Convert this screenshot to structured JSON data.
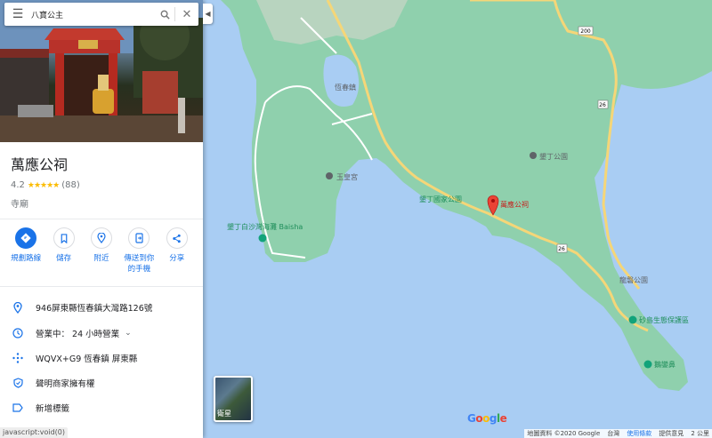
{
  "search": {
    "value": "八寶公主"
  },
  "place": {
    "name": "萬應公祠",
    "rating": "4.2",
    "review_count": "(88)",
    "star_display": "★★★★★",
    "category": "寺廟"
  },
  "actions": [
    {
      "label": "規劃路線"
    },
    {
      "label": "儲存"
    },
    {
      "label": "附近"
    },
    {
      "label": "傳送到你的手機"
    },
    {
      "label": "分享"
    }
  ],
  "info": {
    "address": "946屏東縣恆春鎮大灣路126號",
    "hours": "營業中： 24 小時營業",
    "plus_code": "WQVX+G9 恆春鎮 屏東縣",
    "claim": "聲明商家擁有權",
    "add_label": "新增標籤"
  },
  "statusbar": "javascript:void(0)",
  "map": {
    "places": [
      {
        "label": "恆春鎮"
      },
      {
        "label": "玉皇宮"
      },
      {
        "label": "墾丁公園"
      },
      {
        "label": "墾丁國家公園"
      },
      {
        "label": "萬應公祠"
      },
      {
        "label": "墾丁白沙灣海灘 Baisha"
      },
      {
        "label": "龍磐公園"
      },
      {
        "label": "砂島生態保護區"
      },
      {
        "label": "鵝鑾鼻"
      }
    ],
    "road_shields": [
      "200",
      "26",
      "26"
    ],
    "satellite_label": "衛星",
    "logo": "Google",
    "attribution": [
      "地圖資料 ©2020 Google",
      "台灣",
      "使用條款",
      "提供意見",
      "2 公里"
    ],
    "colors": {
      "water": "#a9cdf3",
      "land": "#8fd0ad",
      "road": "#f5d678",
      "pin": "#ea4335"
    }
  }
}
